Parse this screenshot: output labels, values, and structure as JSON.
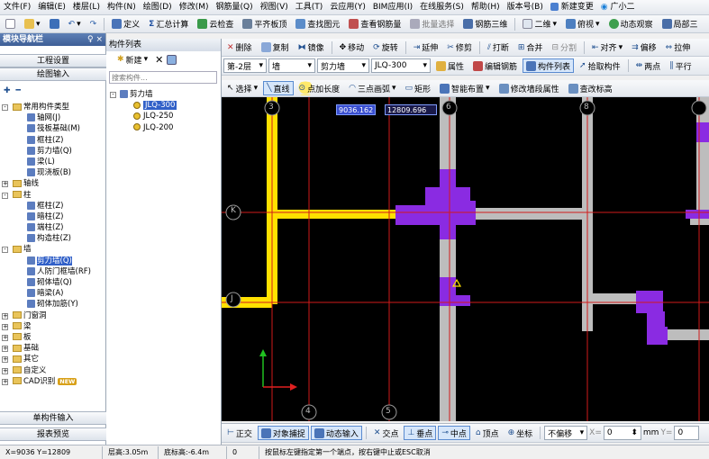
{
  "menubar": [
    "文件(F)",
    "编辑(E)",
    "楼层(L)",
    "构件(N)",
    "绘图(D)",
    "修改(M)",
    "钢筋量(Q)",
    "视图(V)",
    "工具(T)",
    "云应用(Y)",
    "BIM应用(I)",
    "在线服务(S)",
    "帮助(H)",
    "版本号(B)",
    "新建变更",
    "广小二"
  ],
  "toolbar1": [
    "定义",
    "汇总计算",
    "云检查",
    "平齐板顶",
    "查找图元",
    "查看钢筋量",
    "批量选择",
    "钢筋三维",
    "二维",
    "俯视",
    "动态观察",
    "局部三"
  ],
  "toolbar2": [
    "删除",
    "复制",
    "镜像",
    "移动",
    "旋转",
    "延伸",
    "修剪",
    "打断",
    "合并",
    "分割",
    "对齐",
    "偏移",
    "拉伸"
  ],
  "toolbar3": {
    "floor": "第-2层",
    "type": "墙",
    "subtype": "剪力墙",
    "component": "JLQ-300",
    "buttons": [
      "属性",
      "编辑钢筋",
      "构件列表",
      "拾取构件",
      "两点",
      "平行"
    ]
  },
  "toolbar4": [
    "选择",
    "直线",
    "点加长度",
    "三点画弧",
    "矩形",
    "智能布置",
    "修改墙段属性",
    "查改标高"
  ],
  "left_panel": {
    "title": "模块导航栏",
    "pin": "♀ ×",
    "buttons": [
      "工程设置",
      "绘图输入"
    ],
    "tree": [
      {
        "label": "常用构件类型",
        "level": 1,
        "type": "folder",
        "exp": "-"
      },
      {
        "label": "轴网(J)",
        "level": 2,
        "type": "leaf"
      },
      {
        "label": "筏板基础(M)",
        "level": 2,
        "type": "leaf"
      },
      {
        "label": "框柱(Z)",
        "level": 2,
        "type": "leaf"
      },
      {
        "label": "剪力墙(Q)",
        "level": 2,
        "type": "leaf"
      },
      {
        "label": "梁(L)",
        "level": 2,
        "type": "leaf"
      },
      {
        "label": "现浇板(B)",
        "level": 2,
        "type": "leaf"
      },
      {
        "label": "轴线",
        "level": 1,
        "type": "folder",
        "exp": "+"
      },
      {
        "label": "柱",
        "level": 1,
        "type": "folder",
        "exp": "-"
      },
      {
        "label": "框柱(Z)",
        "level": 2,
        "type": "leaf"
      },
      {
        "label": "暗柱(Z)",
        "level": 2,
        "type": "leaf"
      },
      {
        "label": "端柱(Z)",
        "level": 2,
        "type": "leaf"
      },
      {
        "label": "构造柱(Z)",
        "level": 2,
        "type": "leaf"
      },
      {
        "label": "墙",
        "level": 1,
        "type": "folder",
        "exp": "-"
      },
      {
        "label": "剪力墙(Q)",
        "level": 2,
        "type": "leaf",
        "selected": true
      },
      {
        "label": "人防门框墙(RF)",
        "level": 2,
        "type": "leaf"
      },
      {
        "label": "砌体墙(Q)",
        "level": 2,
        "type": "leaf"
      },
      {
        "label": "暗梁(A)",
        "level": 2,
        "type": "leaf"
      },
      {
        "label": "砌体加筋(Y)",
        "level": 2,
        "type": "leaf"
      },
      {
        "label": "门窗洞",
        "level": 1,
        "type": "folder",
        "exp": "+"
      },
      {
        "label": "梁",
        "level": 1,
        "type": "folder",
        "exp": "+"
      },
      {
        "label": "板",
        "level": 1,
        "type": "folder",
        "exp": "+"
      },
      {
        "label": "基础",
        "level": 1,
        "type": "folder",
        "exp": "+"
      },
      {
        "label": "其它",
        "level": 1,
        "type": "folder",
        "exp": "+"
      },
      {
        "label": "自定义",
        "level": 1,
        "type": "folder",
        "exp": "+"
      },
      {
        "label": "CAD识别",
        "level": 1,
        "type": "folder",
        "exp": "+",
        "badge": "NEW"
      }
    ],
    "bottom_buttons": [
      "单构件输入",
      "报表预览"
    ]
  },
  "list_panel": {
    "title": "构件列表",
    "new_label": "新建",
    "search_placeholder": "搜索构件...",
    "group": "剪力墙",
    "items": [
      {
        "label": "JLQ-300",
        "selected": true
      },
      {
        "label": "JLQ-250",
        "selected": false
      },
      {
        "label": "JLQ-200",
        "selected": false
      }
    ]
  },
  "canvas": {
    "coord_x": "9036.162",
    "coord_y": "12809.696",
    "axis_labels": [
      "3",
      "6",
      "8",
      "K",
      "J",
      "4",
      "5"
    ],
    "colors": {
      "bg": "#000000",
      "axis": "#d11a1a",
      "wall": "#bdbdbd",
      "column": "#8a2be2",
      "selected": "#ffe100",
      "ucs_x": "#e02020",
      "ucs_y": "#20c020"
    }
  },
  "snapbar": {
    "buttons": [
      "正交",
      "对象捕捉",
      "动态输入",
      "交点",
      "垂点",
      "中点",
      "顶点",
      "坐标"
    ],
    "offset_mode": "不偏移",
    "x_label": "X=",
    "x_value": "0",
    "unit_mm": "mm",
    "y_label": "Y=",
    "y_value": "0",
    "unit_mm2": "mm"
  },
  "statusbar": {
    "coords": "X=9036 Y=12809",
    "floor_height": "层高:3.05m",
    "bottom_elevation": "底标高:-6.4m",
    "zero": "0",
    "hint": "按鼠标左键指定第一个端点，按右键中止或ESC取消"
  }
}
